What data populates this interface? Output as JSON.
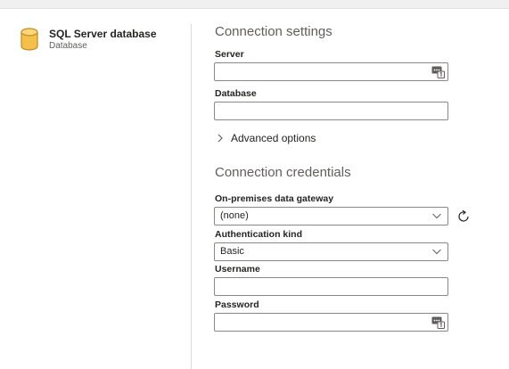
{
  "connector": {
    "name": "SQL Server database",
    "type": "Database"
  },
  "connection_settings": {
    "title": "Connection settings",
    "server": {
      "label": "Server",
      "value": ""
    },
    "database": {
      "label": "Database",
      "value": ""
    },
    "advanced_options_label": "Advanced options"
  },
  "credentials": {
    "title": "Connection credentials",
    "gateway": {
      "label": "On-premises data gateway",
      "selected": "(none)"
    },
    "auth_kind": {
      "label": "Authentication kind",
      "selected": "Basic"
    },
    "username": {
      "label": "Username",
      "value": ""
    },
    "password": {
      "label": "Password",
      "value": ""
    }
  },
  "icons": {
    "connector": "database-icon",
    "server_field": "parameter-icon",
    "password_field": "parameter-icon",
    "gateway_refresh": "refresh-icon",
    "dropdown": "chevron-down-icon",
    "expand": "chevron-right-icon"
  },
  "colors": {
    "database_icon": "#f5c04a",
    "database_icon_outline": "#c08a1e",
    "field_border": "#8a8886",
    "title_text": "#605e5c"
  }
}
